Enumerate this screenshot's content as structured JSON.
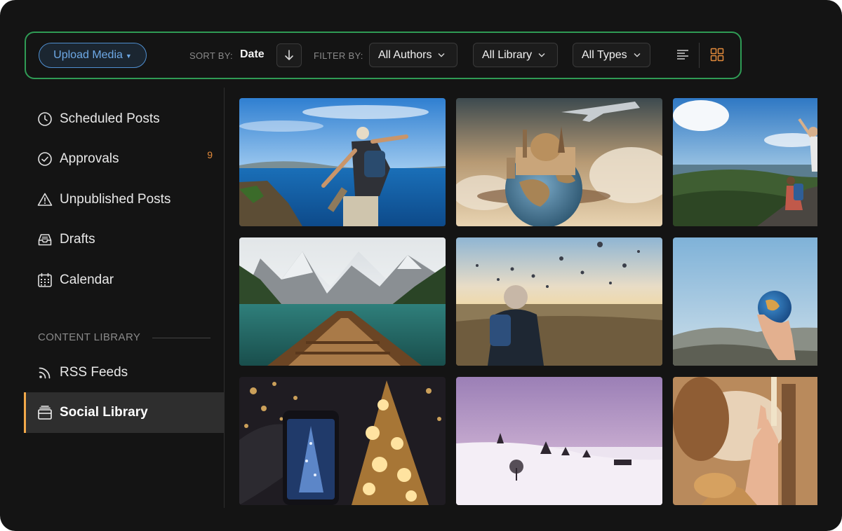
{
  "toolbar": {
    "upload_label": "Upload Media",
    "sort_by_label": "SORT BY:",
    "sort_value": "Date",
    "filter_by_label": "FILTER BY:",
    "filter_authors": "All Authors",
    "filter_library": "All Library",
    "filter_types": "All Types",
    "active_view": "grid"
  },
  "sidebar": {
    "items": [
      {
        "label": "Scheduled Posts",
        "icon": "clock-icon"
      },
      {
        "label": "Approvals",
        "icon": "check-circle-icon",
        "count": "9"
      },
      {
        "label": "Unpublished Posts",
        "icon": "warning-icon"
      },
      {
        "label": "Drafts",
        "icon": "inbox-icon"
      },
      {
        "label": "Calendar",
        "icon": "calendar-icon"
      }
    ],
    "section_title": "CONTENT LIBRARY",
    "library_items": [
      {
        "label": "RSS Feeds",
        "icon": "rss-icon"
      },
      {
        "label": "Social Library",
        "icon": "library-icon",
        "active": true
      }
    ]
  },
  "media": [
    {
      "name": "traveler-coast-photo"
    },
    {
      "name": "globe-landmarks-photo"
    },
    {
      "name": "hikers-mountain-photo"
    },
    {
      "name": "boat-lake-photo"
    },
    {
      "name": "balloons-traveler-photo"
    },
    {
      "name": "hand-globe-photo"
    },
    {
      "name": "phone-christmas-tree-photo"
    },
    {
      "name": "snow-landscape-photo"
    },
    {
      "name": "raised-hands-photo"
    }
  ],
  "colors": {
    "accent_orange": "#e28a3b",
    "toolbar_border": "#2f9b55",
    "upload_blue": "#4f8fd0",
    "background": "#141414"
  }
}
